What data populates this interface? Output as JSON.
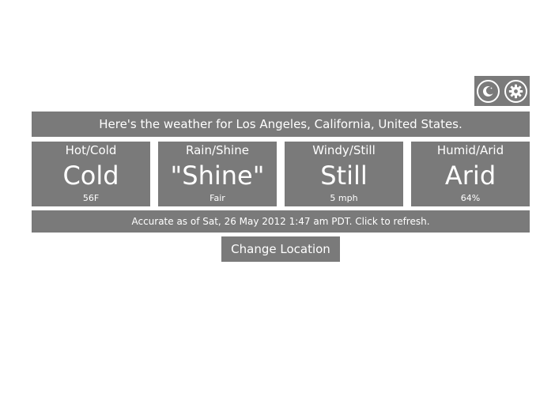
{
  "toolbar": {
    "night_mode_icon": "moon-icon",
    "settings_icon": "gear-icon"
  },
  "header": {
    "location_text": "Here's the weather for Los Angeles, California, United States."
  },
  "tiles": [
    {
      "title": "Hot/Cold",
      "value": "Cold",
      "detail": "56F"
    },
    {
      "title": "Rain/Shine",
      "value": "\"Shine\"",
      "detail": "Fair"
    },
    {
      "title": "Windy/Still",
      "value": "Still",
      "detail": "5 mph"
    },
    {
      "title": "Humid/Arid",
      "value": "Arid",
      "detail": "64%"
    }
  ],
  "status": {
    "text": "Accurate as of Sat, 26 May 2012 1:47 am PDT. Click to refresh."
  },
  "actions": {
    "change_location_label": "Change Location"
  },
  "colors": {
    "panel": "#7a7a7a",
    "text": "#ffffff",
    "background": "#ffffff"
  }
}
